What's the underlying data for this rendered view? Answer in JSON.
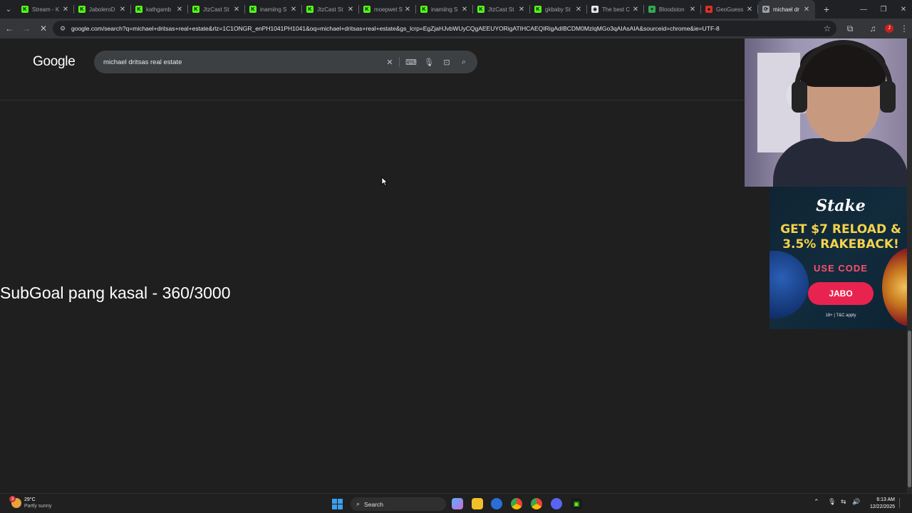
{
  "browser": {
    "tabs": [
      {
        "label": "Stream - K",
        "favicon_color": "#53fc18",
        "favicon_glyph": "K"
      },
      {
        "label": "JaboleroD",
        "favicon_color": "#53fc18",
        "favicon_glyph": "K"
      },
      {
        "label": "kathgamb",
        "favicon_color": "#53fc18",
        "favicon_glyph": "K"
      },
      {
        "label": "JtzCast St",
        "favicon_color": "#53fc18",
        "favicon_glyph": "K"
      },
      {
        "label": "inamiing S",
        "favicon_color": "#53fc18",
        "favicon_glyph": "K"
      },
      {
        "label": "JtzCast St",
        "favicon_color": "#53fc18",
        "favicon_glyph": "K"
      },
      {
        "label": "moepwet S",
        "favicon_color": "#53fc18",
        "favicon_glyph": "K"
      },
      {
        "label": "inamiing S",
        "favicon_color": "#53fc18",
        "favicon_glyph": "K"
      },
      {
        "label": "JtzCast St",
        "favicon_color": "#53fc18",
        "favicon_glyph": "K"
      },
      {
        "label": "gkbaby St",
        "favicon_color": "#53fc18",
        "favicon_glyph": "K"
      },
      {
        "label": "The best C",
        "favicon_color": "#e8eaed",
        "favicon_glyph": "◉"
      },
      {
        "label": "Bloodston",
        "favicon_color": "#34a853",
        "favicon_glyph": "+"
      },
      {
        "label": "GeoGuess",
        "favicon_color": "#d93025",
        "favicon_glyph": "●"
      },
      {
        "label": "michael dr",
        "favicon_color": "#9aa0a6",
        "favicon_glyph": "⟳",
        "active": true
      }
    ],
    "address": "google.com/search?q=michael+dritsas+real+estate&rlz=1C1ONGR_enPH1041PH1041&oq=michael+dritsas+real+estate&gs_lcrp=EgZjaHJvbWUyCQgAEEUYORigATIHCAEQIRigAdIBCDM0MzlqMGo3qAIAsAIA&sourceid=chrome&ie=UTF-8"
  },
  "google": {
    "logo": "Google",
    "query": "michael dritsas real estate"
  },
  "overlay": {
    "subgoal": "SubGoal pang kasal - 360/3000"
  },
  "ad": {
    "brand": "Stake",
    "headline_1": "GET $7 RELOAD &",
    "headline_2": "3.5% RAKEBACK!",
    "use_code": "USE CODE",
    "code": "JABO",
    "legal": "18+ | T&C apply"
  },
  "taskbar": {
    "weather_temp": "29°C",
    "weather_desc": "Partly sunny",
    "weather_badge": "3",
    "search_label": "Search",
    "time": "6:13 AM",
    "date": "12/22/2025"
  }
}
